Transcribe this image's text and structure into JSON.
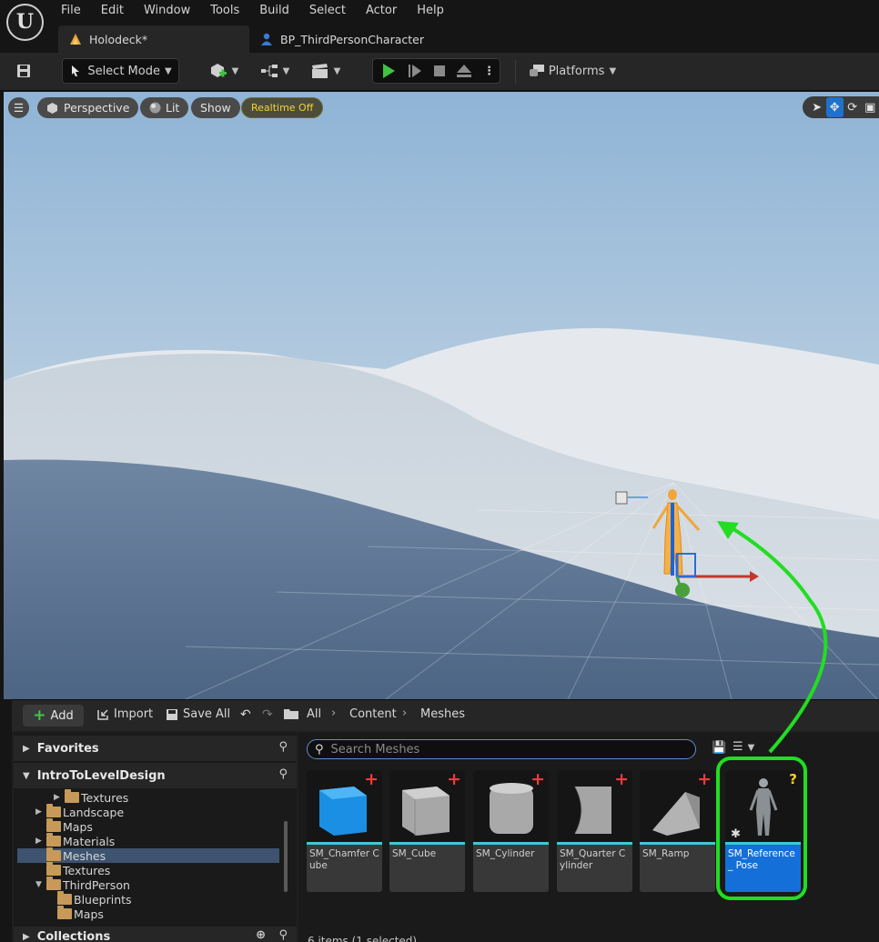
{
  "menu": [
    "File",
    "Edit",
    "Window",
    "Tools",
    "Build",
    "Select",
    "Actor",
    "Help"
  ],
  "tabs": [
    {
      "label": "Holodeck*",
      "active": true
    },
    {
      "label": "BP_ThirdPersonCharacter",
      "active": false
    }
  ],
  "toolbar": {
    "select_mode": "Select Mode",
    "platforms": "Platforms"
  },
  "viewport": {
    "perspective": "Perspective",
    "lit": "Lit",
    "show": "Show",
    "realtime": "Realtime Off"
  },
  "content_browser": {
    "add": "Add",
    "import": "Import",
    "save_all": "Save All",
    "breadcrumb": [
      "All",
      "Content",
      "Meshes"
    ],
    "favorites": "Favorites",
    "root": "IntroToLevelDesign",
    "collections": "Collections",
    "tree": [
      "Textures",
      "Landscape",
      "Maps",
      "Materials",
      "Meshes",
      "Textures",
      "ThirdPerson",
      "Blueprints",
      "Maps"
    ],
    "search_placeholder": "Search Meshes",
    "assets": [
      {
        "name": "SM_Chamfer Cube"
      },
      {
        "name": "SM_Cube"
      },
      {
        "name": "SM_Cylinder"
      },
      {
        "name": "SM_Quarter Cylinder"
      },
      {
        "name": "SM_Ramp"
      },
      {
        "name": "SM_Reference_ Pose"
      }
    ],
    "status": "6 items (1 selected)"
  },
  "colors": {
    "accent_blue": "#1470d8",
    "highlight_green": "#22dd22",
    "play_green": "#3ec43e"
  }
}
